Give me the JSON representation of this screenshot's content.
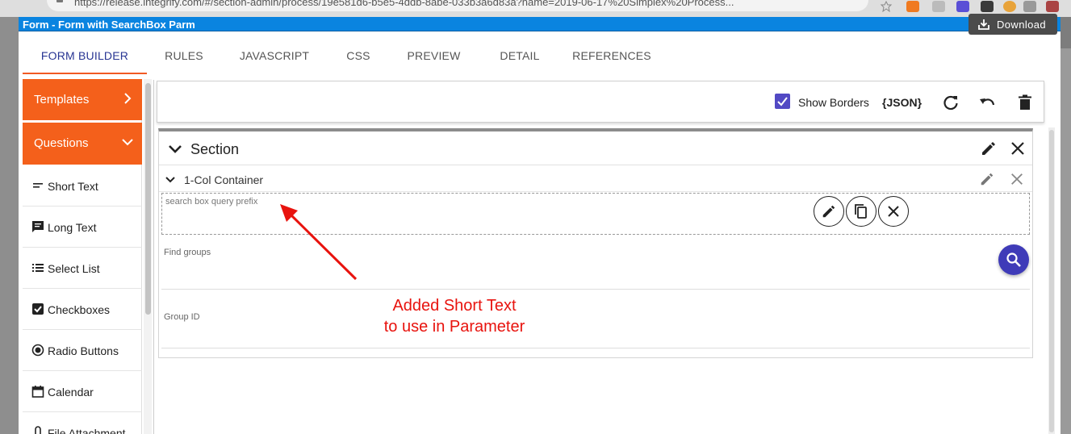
{
  "browser": {
    "url": "https://release.integrify.com/#/section-admin/process/19e581d6-b5e5-4ddb-8abe-033b3a6d83a?name=2019-06-17%20Simplex%20Process..."
  },
  "modal": {
    "title": "Form - Form with SearchBox Parm",
    "download_label": "Download"
  },
  "tabs": [
    {
      "label": "FORM BUILDER",
      "active": true
    },
    {
      "label": "RULES"
    },
    {
      "label": "JAVASCRIPT"
    },
    {
      "label": "CSS"
    },
    {
      "label": "PREVIEW"
    },
    {
      "label": "DETAIL"
    },
    {
      "label": "REFERENCES"
    }
  ],
  "sidebar": {
    "templates_label": "Templates",
    "questions_label": "Questions",
    "items": [
      {
        "label": "Short Text",
        "icon": "short-text-icon"
      },
      {
        "label": "Long Text",
        "icon": "long-text-icon"
      },
      {
        "label": "Select List",
        "icon": "select-list-icon"
      },
      {
        "label": "Checkboxes",
        "icon": "checkbox-icon"
      },
      {
        "label": "Radio Buttons",
        "icon": "radio-button-icon"
      },
      {
        "label": "Calendar",
        "icon": "calendar-icon"
      },
      {
        "label": "File Attachment",
        "icon": "attachment-icon"
      }
    ]
  },
  "toolbar": {
    "show_borders_label": "Show Borders",
    "show_borders_checked": true,
    "json_label": "{JSON}"
  },
  "section": {
    "title": "Section",
    "container_title": "1-Col Container",
    "fields": [
      {
        "label": "search box query prefix"
      },
      {
        "label": "Find groups"
      },
      {
        "label": "Group ID"
      }
    ]
  },
  "annotation": {
    "line1": "Added Short Text",
    "line2": "to use in Parameter",
    "color": "#e8130e"
  },
  "colors": {
    "accent_orange": "#f4601b",
    "tab_active": "#283593",
    "title_bar": "#0a84e0",
    "fab": "#3f3bb8"
  }
}
